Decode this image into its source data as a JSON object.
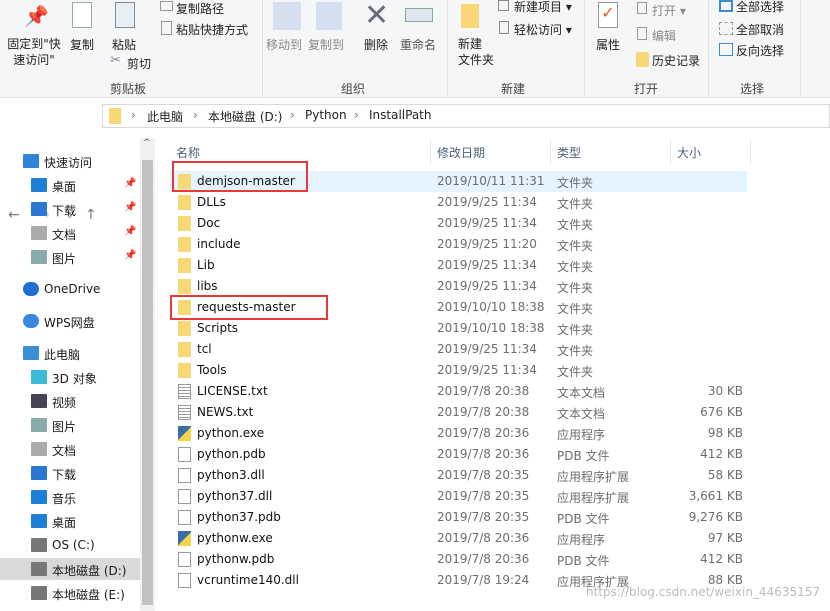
{
  "ribbon": {
    "clipboard": {
      "pin": "固定到\"快速访问\"",
      "pin_l1": "固定到\"快",
      "pin_l2": "速访问\"",
      "copy": "复制",
      "paste": "粘贴",
      "copy_path": "复制路径",
      "paste_shortcut": "粘贴快捷方式",
      "cut": "剪切",
      "group": "剪贴板"
    },
    "organize": {
      "move_to": "移动到",
      "copy_to": "复制到",
      "delete": "删除",
      "rename": "重命名",
      "group": "组织"
    },
    "new": {
      "new_folder_l1": "新建",
      "new_folder_l2": "文件夹",
      "new_item": "新建项目",
      "easy_access": "轻松访问",
      "group": "新建"
    },
    "open": {
      "properties": "属性",
      "open": "打开",
      "edit": "编辑",
      "history": "历史记录",
      "group": "打开"
    },
    "select": {
      "select_all": "全部选择",
      "select_none": "全部取消",
      "invert": "反向选择",
      "group": "选择"
    }
  },
  "address": {
    "crumbs": [
      "此电脑",
      "本地磁盘 (D:)",
      "Python",
      "InstallPath"
    ]
  },
  "sidebar": {
    "items": [
      {
        "label": "快速访问"
      },
      {
        "label": "桌面"
      },
      {
        "label": "下载"
      },
      {
        "label": "文档"
      },
      {
        "label": "图片"
      },
      {
        "label": "OneDrive"
      },
      {
        "label": "WPS网盘"
      },
      {
        "label": "此电脑"
      },
      {
        "label": "3D 对象"
      },
      {
        "label": "视频"
      },
      {
        "label": "图片"
      },
      {
        "label": "文档"
      },
      {
        "label": "下载"
      },
      {
        "label": "音乐"
      },
      {
        "label": "桌面"
      },
      {
        "label": "OS (C:)"
      },
      {
        "label": "本地磁盘 (D:)"
      },
      {
        "label": "本地磁盘 (E:)"
      }
    ]
  },
  "columns": {
    "name": "名称",
    "date": "修改日期",
    "type": "类型",
    "size": "大小"
  },
  "files": [
    {
      "name": "demjson-master",
      "date": "2019/10/11 11:31",
      "type": "文件夹",
      "size": "",
      "icon": "folder"
    },
    {
      "name": "DLLs",
      "date": "2019/9/25 11:34",
      "type": "文件夹",
      "size": "",
      "icon": "folder"
    },
    {
      "name": "Doc",
      "date": "2019/9/25 11:34",
      "type": "文件夹",
      "size": "",
      "icon": "folder"
    },
    {
      "name": "include",
      "date": "2019/9/25 11:20",
      "type": "文件夹",
      "size": "",
      "icon": "folder"
    },
    {
      "name": "Lib",
      "date": "2019/9/25 11:34",
      "type": "文件夹",
      "size": "",
      "icon": "folder"
    },
    {
      "name": "libs",
      "date": "2019/9/25 11:34",
      "type": "文件夹",
      "size": "",
      "icon": "folder"
    },
    {
      "name": "requests-master",
      "date": "2019/10/10 18:38",
      "type": "文件夹",
      "size": "",
      "icon": "folder"
    },
    {
      "name": "Scripts",
      "date": "2019/10/10 18:38",
      "type": "文件夹",
      "size": "",
      "icon": "folder"
    },
    {
      "name": "tcl",
      "date": "2019/9/25 11:34",
      "type": "文件夹",
      "size": "",
      "icon": "folder"
    },
    {
      "name": "Tools",
      "date": "2019/9/25 11:34",
      "type": "文件夹",
      "size": "",
      "icon": "folder"
    },
    {
      "name": "LICENSE.txt",
      "date": "2019/7/8 20:38",
      "type": "文本文档",
      "size": "30 KB",
      "icon": "text"
    },
    {
      "name": "NEWS.txt",
      "date": "2019/7/8 20:38",
      "type": "文本文档",
      "size": "676 KB",
      "icon": "text"
    },
    {
      "name": "python.exe",
      "date": "2019/7/8 20:36",
      "type": "应用程序",
      "size": "98 KB",
      "icon": "python"
    },
    {
      "name": "python.pdb",
      "date": "2019/7/8 20:36",
      "type": "PDB 文件",
      "size": "412 KB",
      "icon": "file"
    },
    {
      "name": "python3.dll",
      "date": "2019/7/8 20:35",
      "type": "应用程序扩展",
      "size": "58 KB",
      "icon": "dll"
    },
    {
      "name": "python37.dll",
      "date": "2019/7/8 20:35",
      "type": "应用程序扩展",
      "size": "3,661 KB",
      "icon": "dll"
    },
    {
      "name": "python37.pdb",
      "date": "2019/7/8 20:35",
      "type": "PDB 文件",
      "size": "9,276 KB",
      "icon": "file"
    },
    {
      "name": "pythonw.exe",
      "date": "2019/7/8 20:36",
      "type": "应用程序",
      "size": "97 KB",
      "icon": "python"
    },
    {
      "name": "pythonw.pdb",
      "date": "2019/7/8 20:36",
      "type": "PDB 文件",
      "size": "412 KB",
      "icon": "file"
    },
    {
      "name": "vcruntime140.dll",
      "date": "2019/7/8 19:24",
      "type": "应用程序扩展",
      "size": "88 KB",
      "icon": "dll"
    }
  ],
  "watermark": "https://blog.csdn.net/weixin_44635157",
  "colors": {
    "highlight": "#e63939",
    "folder": "#f8d775",
    "selection": "#e5f3ff"
  }
}
